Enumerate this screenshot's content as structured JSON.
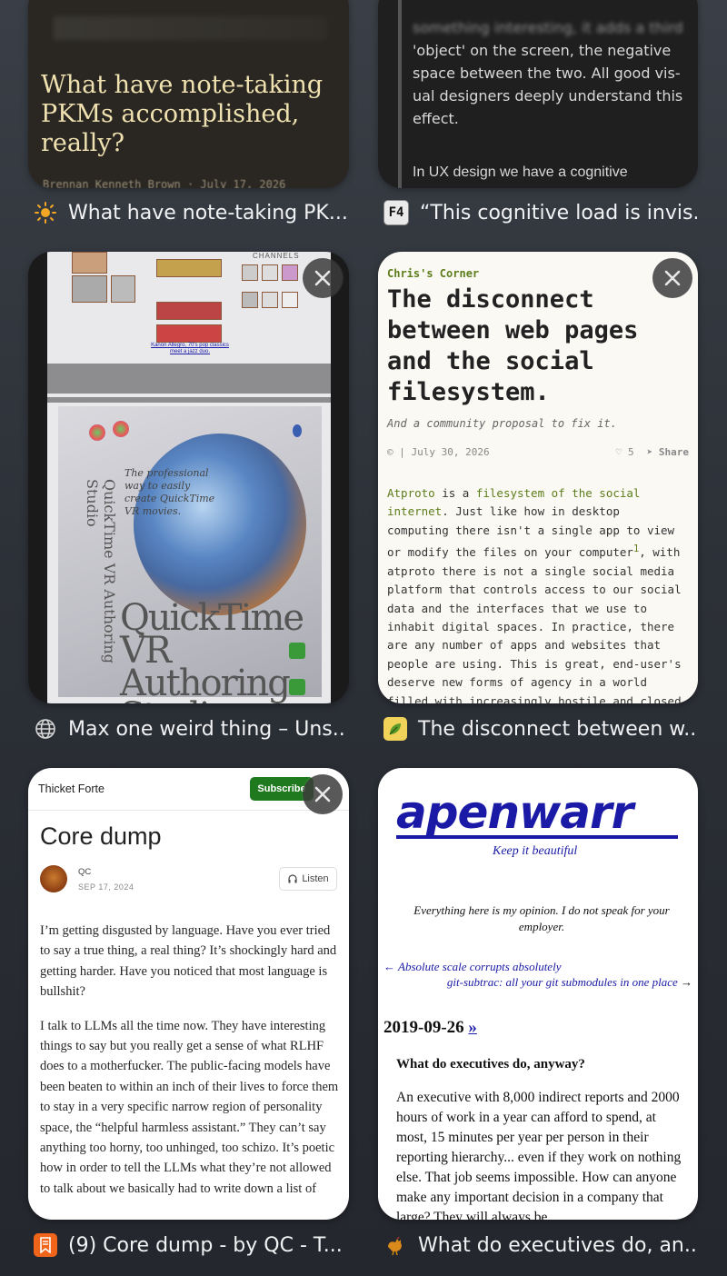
{
  "tabs": [
    {
      "label": "What have note-taking PK...",
      "favicon": "sun-icon",
      "content": {
        "title": "What have note-taking PKMs accomplished, really?",
        "byline": "Brennan Kenneth Brown · July 17, 2026"
      }
    },
    {
      "label": "“This cognitive load is invis...",
      "favicon": "F4",
      "content": {
        "lines": [
          "something interesting, it adds a third",
          "'object' on the screen, the negative",
          "space between the two. All good vis-",
          "ual designers deeply understand this",
          "effect."
        ],
        "line2": "In UX design we have a cognitive"
      }
    },
    {
      "label": "Max one weird thing – Uns...",
      "favicon": "globe-icon",
      "content": {
        "channels": "CHANNELS",
        "link_caption": "Kanon Allegro, 70's pop classics meet a jazz duo.",
        "box_title": "QuickTime VR Authoring Studio",
        "box_small": "The professional way to easily create QuickTime VR movies."
      }
    },
    {
      "label": "The disconnect between w...",
      "favicon": "leaf-icon",
      "content": {
        "site": "Chris's Corner",
        "title": "The disconnect between web pages and the social filesystem.",
        "subtitle": "And a community proposal to fix it.",
        "date": "July 30, 2026",
        "likes": "5",
        "share": "Share",
        "body_link1": "Atproto",
        "body_1": " is a ",
        "body_link2": "filesystem of the social internet",
        "body_2": ". Just like how in desktop computing there isn't a single app to view or modify the files on your computer",
        "body_sup": "1",
        "body_3": ", with atproto there is not a single social media platform that controls access to our social data and the interfaces that we use to inhabit digital spaces. In practice, there are any number of apps and websites that people are using. This is great, end-user's deserve new forms of agency in a world filled with increasingly hostile and closed platforms!"
      }
    },
    {
      "label": "(9) Core dump - by QC - T...",
      "favicon": "bookmark-icon",
      "content": {
        "publication": "Thicket Forte",
        "subscribe": "Subscribe",
        "title": "Core dump",
        "author": "QC",
        "date": "SEP 17, 2024",
        "listen": "Listen",
        "p1": "I’m getting disgusted by language. Have you ever tried to say a true thing, a real thing? It’s shockingly hard and getting harder. Have you noticed that most language is bullshit?",
        "p2": "I talk to LLMs all the time now. They have interesting things to say but you really get a sense of what RLHF does to a motherfucker. The public-facing models have been beaten to within an inch of their lives to force them to stay in a very specific narrow region of personality space, the “helpful harmless assistant.” They can’t say anything too horny, too unhinged, too schizo. It’s poetic how in order to tell the LLMs what they’re not allowed to talk about we basically had to write down a list of"
      }
    },
    {
      "label": "What do executives do, an...",
      "favicon": "rooster-icon",
      "content": {
        "logo": "apenwarr",
        "tagline": "Keep it beautiful",
        "disclaimer": "Everything here is my opinion. I do not speak for your employer.",
        "prev_link": "Absolute scale corrupts absolutely",
        "next_link": "git-subtrac: all your git submodules in one place",
        "date": "2019-09-26",
        "raquo": "»",
        "heading": "What do executives do, anyway?",
        "body": "An executive with 8,000 indirect reports and 2000 hours of work in a year can afford to spend, at most, 15 minutes per year per person in their reporting hierarchy... even if they work on nothing else. That job seems impossible. How can anyone make any important decision in a company that large? They will always be"
      }
    }
  ],
  "colors": {
    "background": "#2c3037",
    "chris_green": "#5c7d1b",
    "apenwarr_blue": "#1a1aa6",
    "substack_green": "#1f7a1f"
  }
}
